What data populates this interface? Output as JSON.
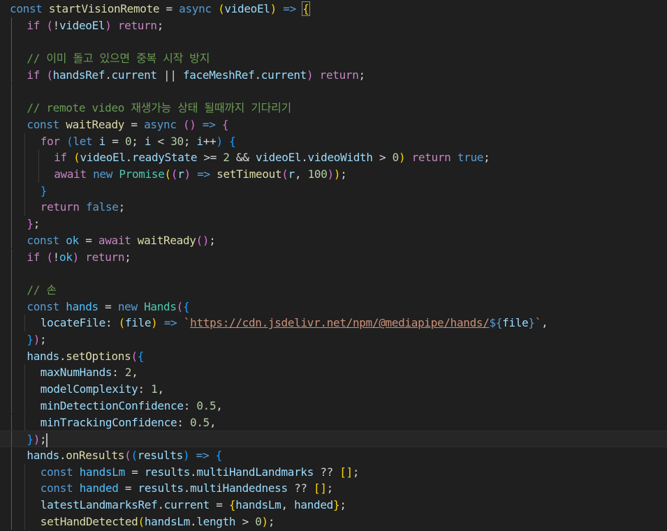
{
  "editor": {
    "language": "javascript",
    "theme": "dark",
    "colors": {
      "background": "#1f1f1f",
      "keyword": "#569cd6",
      "control": "#c586c0",
      "function": "#dcdcaa",
      "variable": "#9cdcfe",
      "constant": "#4fc1ff",
      "class": "#4ec9b0",
      "number": "#b5cea8",
      "string": "#ce9178",
      "comment": "#6a9955",
      "bracket_1": "#ffd700",
      "bracket_2": "#da70d6",
      "bracket_3": "#179fff"
    },
    "current_line": 27,
    "lines": [
      {
        "indent": 0,
        "tokens": [
          [
            "kw",
            "const "
          ],
          [
            "fn",
            "startVisionRemote"
          ],
          [
            "op",
            " = "
          ],
          [
            "kw",
            "async "
          ],
          [
            "p1",
            "("
          ],
          [
            "var",
            "videoEl"
          ],
          [
            "p1",
            ")"
          ],
          [
            "op",
            " "
          ],
          [
            "kw",
            "=>"
          ],
          [
            "op",
            " "
          ],
          [
            "p1b",
            "{"
          ]
        ]
      },
      {
        "indent": 1,
        "tokens": [
          [
            "ctl",
            "if "
          ],
          [
            "p2",
            "("
          ],
          [
            "op",
            "!"
          ],
          [
            "var",
            "videoEl"
          ],
          [
            "p2",
            ")"
          ],
          [
            "op",
            " "
          ],
          [
            "ctl",
            "return"
          ],
          [
            "op",
            ";"
          ]
        ]
      },
      {
        "indent": 1,
        "tokens": []
      },
      {
        "indent": 1,
        "tokens": [
          [
            "comment",
            "// 이미 돌고 있으면 중복 시작 방지"
          ]
        ]
      },
      {
        "indent": 1,
        "tokens": [
          [
            "ctl",
            "if "
          ],
          [
            "p2",
            "("
          ],
          [
            "var",
            "handsRef"
          ],
          [
            "op",
            "."
          ],
          [
            "var",
            "current"
          ],
          [
            "op",
            " || "
          ],
          [
            "var",
            "faceMeshRef"
          ],
          [
            "op",
            "."
          ],
          [
            "var",
            "current"
          ],
          [
            "p2",
            ")"
          ],
          [
            "op",
            " "
          ],
          [
            "ctl",
            "return"
          ],
          [
            "op",
            ";"
          ]
        ]
      },
      {
        "indent": 1,
        "tokens": []
      },
      {
        "indent": 1,
        "tokens": [
          [
            "comment",
            "// remote video 재생가능 상태 될때까지 기다리기"
          ]
        ]
      },
      {
        "indent": 1,
        "tokens": [
          [
            "kw",
            "const "
          ],
          [
            "fn",
            "waitReady"
          ],
          [
            "op",
            " = "
          ],
          [
            "kw",
            "async "
          ],
          [
            "p2",
            "()"
          ],
          [
            "op",
            " "
          ],
          [
            "kw",
            "=>"
          ],
          [
            "op",
            " "
          ],
          [
            "p2",
            "{"
          ]
        ]
      },
      {
        "indent": 2,
        "tokens": [
          [
            "ctl",
            "for "
          ],
          [
            "p3",
            "("
          ],
          [
            "kw",
            "let "
          ],
          [
            "var",
            "i"
          ],
          [
            "op",
            " = "
          ],
          [
            "num",
            "0"
          ],
          [
            "op",
            "; "
          ],
          [
            "var",
            "i"
          ],
          [
            "op",
            " < "
          ],
          [
            "num",
            "30"
          ],
          [
            "op",
            "; "
          ],
          [
            "var",
            "i"
          ],
          [
            "op",
            "++"
          ],
          [
            "p3",
            ")"
          ],
          [
            "op",
            " "
          ],
          [
            "p3",
            "{"
          ]
        ]
      },
      {
        "indent": 3,
        "tokens": [
          [
            "ctl",
            "if "
          ],
          [
            "p1",
            "("
          ],
          [
            "var",
            "videoEl"
          ],
          [
            "op",
            "."
          ],
          [
            "var",
            "readyState"
          ],
          [
            "op",
            " >= "
          ],
          [
            "num",
            "2"
          ],
          [
            "op",
            " && "
          ],
          [
            "var",
            "videoEl"
          ],
          [
            "op",
            "."
          ],
          [
            "var",
            "videoWidth"
          ],
          [
            "op",
            " > "
          ],
          [
            "num",
            "0"
          ],
          [
            "p1",
            ")"
          ],
          [
            "op",
            " "
          ],
          [
            "ctl",
            "return "
          ],
          [
            "kw",
            "true"
          ],
          [
            "op",
            ";"
          ]
        ]
      },
      {
        "indent": 3,
        "tokens": [
          [
            "ctl",
            "await "
          ],
          [
            "kw",
            "new "
          ],
          [
            "class",
            "Promise"
          ],
          [
            "p1",
            "("
          ],
          [
            "p2",
            "("
          ],
          [
            "var",
            "r"
          ],
          [
            "p2",
            ")"
          ],
          [
            "op",
            " "
          ],
          [
            "kw",
            "=>"
          ],
          [
            "op",
            " "
          ],
          [
            "fn",
            "setTimeout"
          ],
          [
            "p2",
            "("
          ],
          [
            "var",
            "r"
          ],
          [
            "op",
            ", "
          ],
          [
            "num",
            "100"
          ],
          [
            "p2",
            ")"
          ],
          [
            "p1",
            ")"
          ],
          [
            "op",
            ";"
          ]
        ]
      },
      {
        "indent": 2,
        "tokens": [
          [
            "p3",
            "}"
          ]
        ]
      },
      {
        "indent": 2,
        "tokens": [
          [
            "ctl",
            "return "
          ],
          [
            "kw",
            "false"
          ],
          [
            "op",
            ";"
          ]
        ]
      },
      {
        "indent": 1,
        "tokens": [
          [
            "p2",
            "}"
          ],
          [
            "op",
            ";"
          ]
        ]
      },
      {
        "indent": 1,
        "tokens": [
          [
            "kw",
            "const "
          ],
          [
            "const",
            "ok"
          ],
          [
            "op",
            " = "
          ],
          [
            "ctl",
            "await "
          ],
          [
            "fn",
            "waitReady"
          ],
          [
            "p2",
            "()"
          ],
          [
            "op",
            ";"
          ]
        ]
      },
      {
        "indent": 1,
        "tokens": [
          [
            "ctl",
            "if "
          ],
          [
            "p2",
            "("
          ],
          [
            "op",
            "!"
          ],
          [
            "const",
            "ok"
          ],
          [
            "p2",
            ")"
          ],
          [
            "op",
            " "
          ],
          [
            "ctl",
            "return"
          ],
          [
            "op",
            ";"
          ]
        ]
      },
      {
        "indent": 1,
        "tokens": []
      },
      {
        "indent": 1,
        "tokens": [
          [
            "comment",
            "// 손"
          ]
        ]
      },
      {
        "indent": 1,
        "tokens": [
          [
            "kw",
            "const "
          ],
          [
            "const",
            "hands"
          ],
          [
            "op",
            " = "
          ],
          [
            "kw",
            "new "
          ],
          [
            "class",
            "Hands"
          ],
          [
            "p2",
            "("
          ],
          [
            "p3",
            "{"
          ]
        ]
      },
      {
        "indent": 2,
        "tokens": [
          [
            "var",
            "locateFile"
          ],
          [
            "op",
            ": "
          ],
          [
            "p1",
            "("
          ],
          [
            "var",
            "file"
          ],
          [
            "p1",
            ")"
          ],
          [
            "op",
            " "
          ],
          [
            "kw",
            "=>"
          ],
          [
            "op",
            " "
          ],
          [
            "str",
            "`"
          ],
          [
            "strlink",
            "https://cdn.jsdelivr.net/npm/@mediapipe/hands/"
          ],
          [
            "kw",
            "${"
          ],
          [
            "var",
            "file"
          ],
          [
            "kw",
            "}"
          ],
          [
            "str",
            "`"
          ],
          [
            "op",
            ","
          ]
        ]
      },
      {
        "indent": 1,
        "tokens": [
          [
            "p3",
            "}"
          ],
          [
            "p2",
            ")"
          ],
          [
            "op",
            ";"
          ]
        ]
      },
      {
        "indent": 1,
        "tokens": [
          [
            "var",
            "hands"
          ],
          [
            "op",
            "."
          ],
          [
            "fn",
            "setOptions"
          ],
          [
            "p2",
            "("
          ],
          [
            "p3",
            "{"
          ]
        ]
      },
      {
        "indent": 2,
        "tokens": [
          [
            "var",
            "maxNumHands"
          ],
          [
            "op",
            ": "
          ],
          [
            "num",
            "2"
          ],
          [
            "op",
            ","
          ]
        ]
      },
      {
        "indent": 2,
        "tokens": [
          [
            "var",
            "modelComplexity"
          ],
          [
            "op",
            ": "
          ],
          [
            "num",
            "1"
          ],
          [
            "op",
            ","
          ]
        ]
      },
      {
        "indent": 2,
        "tokens": [
          [
            "var",
            "minDetectionConfidence"
          ],
          [
            "op",
            ": "
          ],
          [
            "num",
            "0.5"
          ],
          [
            "op",
            ","
          ]
        ]
      },
      {
        "indent": 2,
        "tokens": [
          [
            "var",
            "minTrackingConfidence"
          ],
          [
            "op",
            ": "
          ],
          [
            "num",
            "0.5"
          ],
          [
            "op",
            ","
          ]
        ]
      },
      {
        "indent": 1,
        "tokens": [
          [
            "p3",
            "}"
          ],
          [
            "p2",
            ")"
          ],
          [
            "op",
            ";"
          ],
          [
            "cursor",
            ""
          ]
        ]
      },
      {
        "indent": 1,
        "tokens": [
          [
            "var",
            "hands"
          ],
          [
            "op",
            "."
          ],
          [
            "fn",
            "onResults"
          ],
          [
            "p2",
            "("
          ],
          [
            "p3",
            "("
          ],
          [
            "var",
            "results"
          ],
          [
            "p3",
            ")"
          ],
          [
            "op",
            " "
          ],
          [
            "kw",
            "=>"
          ],
          [
            "op",
            " "
          ],
          [
            "p3",
            "{"
          ]
        ]
      },
      {
        "indent": 2,
        "tokens": [
          [
            "kw",
            "const "
          ],
          [
            "const",
            "handsLm"
          ],
          [
            "op",
            " = "
          ],
          [
            "var",
            "results"
          ],
          [
            "op",
            "."
          ],
          [
            "var",
            "multiHandLandmarks"
          ],
          [
            "op",
            " ?? "
          ],
          [
            "p1",
            "[]"
          ],
          [
            "op",
            ";"
          ]
        ]
      },
      {
        "indent": 2,
        "tokens": [
          [
            "kw",
            "const "
          ],
          [
            "const",
            "handed"
          ],
          [
            "op",
            " = "
          ],
          [
            "var",
            "results"
          ],
          [
            "op",
            "."
          ],
          [
            "var",
            "multiHandedness"
          ],
          [
            "op",
            " ?? "
          ],
          [
            "p1",
            "[]"
          ],
          [
            "op",
            ";"
          ]
        ]
      },
      {
        "indent": 2,
        "tokens": [
          [
            "var",
            "latestLandmarksRef"
          ],
          [
            "op",
            "."
          ],
          [
            "var",
            "current"
          ],
          [
            "op",
            " = "
          ],
          [
            "p1",
            "{"
          ],
          [
            "var",
            "handsLm"
          ],
          [
            "op",
            ", "
          ],
          [
            "var",
            "handed"
          ],
          [
            "p1",
            "}"
          ],
          [
            "op",
            ";"
          ]
        ]
      },
      {
        "indent": 2,
        "tokens": [
          [
            "fn",
            "setHandDetected"
          ],
          [
            "p1",
            "("
          ],
          [
            "var",
            "handsLm"
          ],
          [
            "op",
            "."
          ],
          [
            "var",
            "length"
          ],
          [
            "op",
            " > "
          ],
          [
            "num",
            "0"
          ],
          [
            "p1",
            ")"
          ],
          [
            "op",
            ";"
          ]
        ]
      }
    ]
  }
}
